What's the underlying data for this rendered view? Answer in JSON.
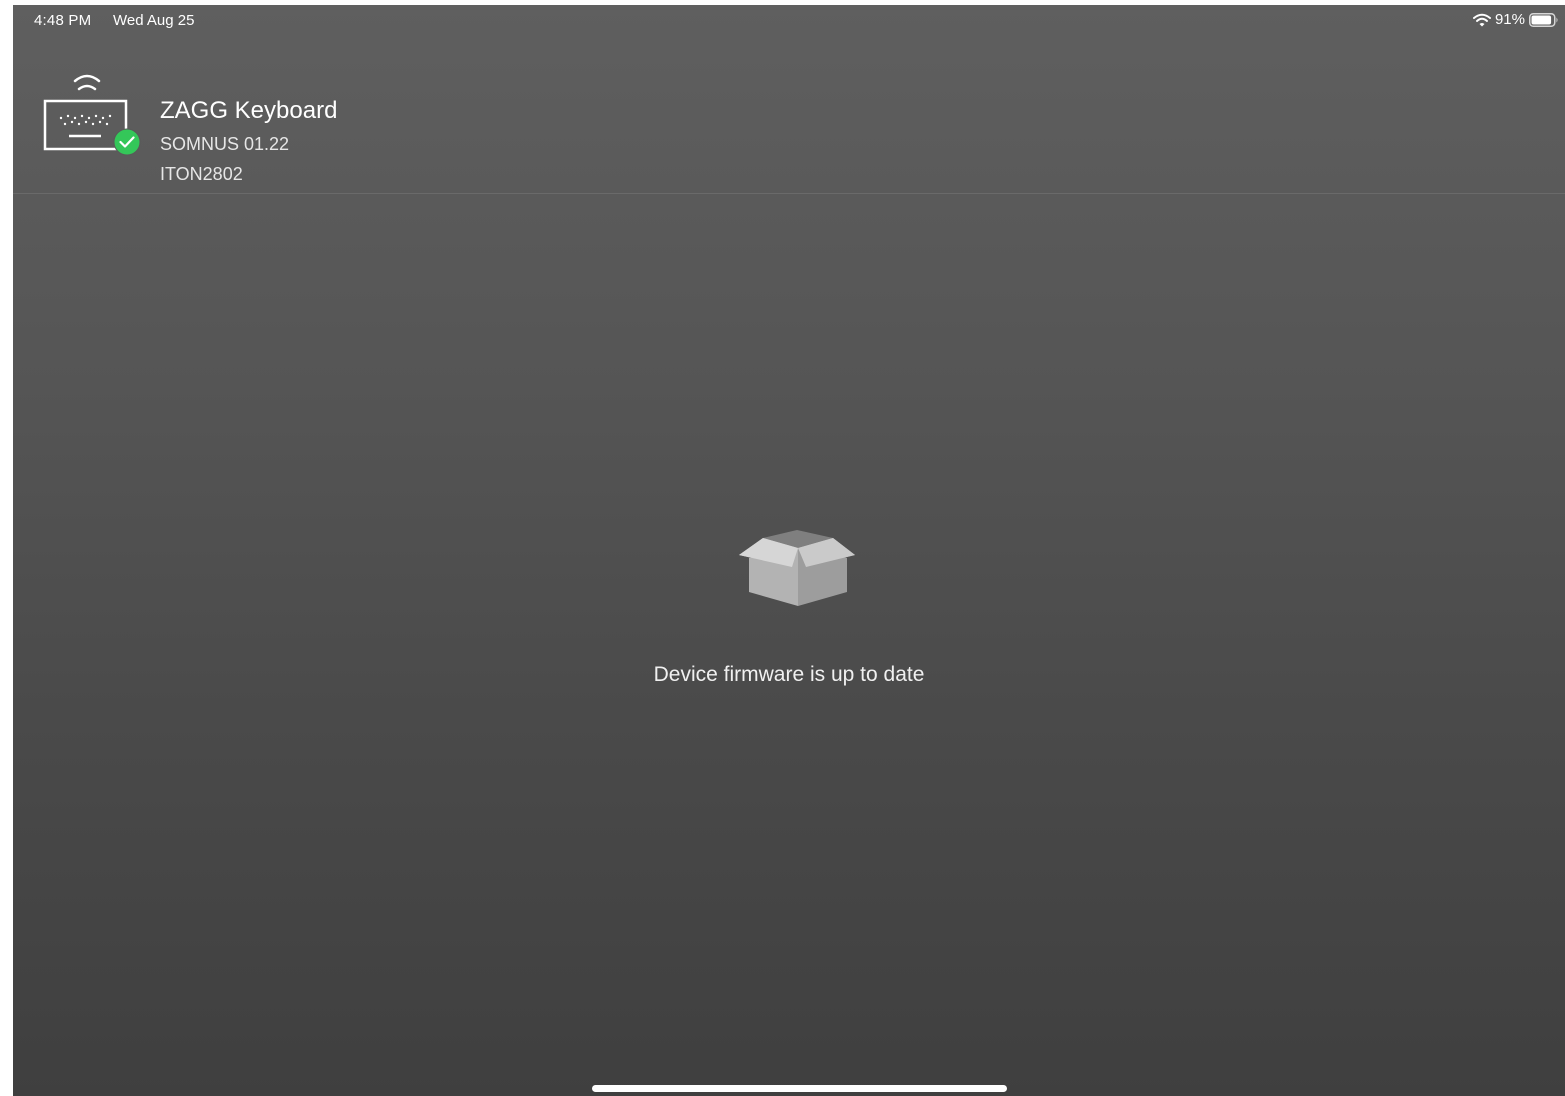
{
  "status_bar": {
    "time": "4:48 PM",
    "date": "Wed Aug 25",
    "battery_percent": "91%",
    "battery_level": 0.91,
    "wifi_icon": "wifi-icon",
    "battery_icon": "battery-icon"
  },
  "device": {
    "name": "ZAGG Keyboard",
    "model": "SOMNUS 01.22",
    "serial": "ITON2802",
    "icon": "keyboard-wireless-icon",
    "connected_badge": "check-badge-icon",
    "badge_color": "#34c759"
  },
  "main": {
    "icon": "open-box-icon",
    "message": "Device firmware is up to date"
  }
}
